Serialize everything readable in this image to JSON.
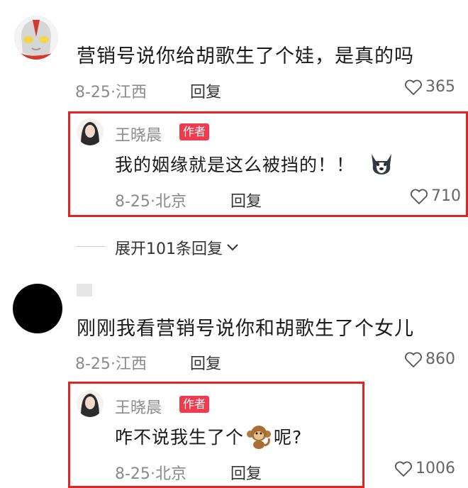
{
  "comments": [
    {
      "text": "营销号说你给胡歌生了个娃，是真的吗",
      "date": "8-25",
      "location": "江西",
      "reply_label": "回复",
      "likes": "365",
      "author_reply": {
        "name": "王晓晨",
        "badge": "作者",
        "text": "我的姻缘就是这么被挡的！！",
        "emoji": "husky-dog-emoji",
        "date": "8-25",
        "location": "北京",
        "reply_label": "回复",
        "likes": "710"
      }
    },
    {
      "text": "刚刚我看营销号说你和胡歌生了个女儿",
      "date": "8-25",
      "location": "江西",
      "reply_label": "回复",
      "likes": "860",
      "author_reply": {
        "name": "王晓晨",
        "badge": "作者",
        "text_before": "咋不说我生了个",
        "emoji": "monkey-emoji",
        "text_after": "呢?",
        "date": "8-25",
        "location": "北京",
        "reply_label": "回复",
        "likes": "1006"
      }
    }
  ],
  "expand_replies": "展开101条回复",
  "meta_separator": "·",
  "colors": {
    "highlight_border": "#e02323",
    "author_badge": "#ef3b4b"
  }
}
